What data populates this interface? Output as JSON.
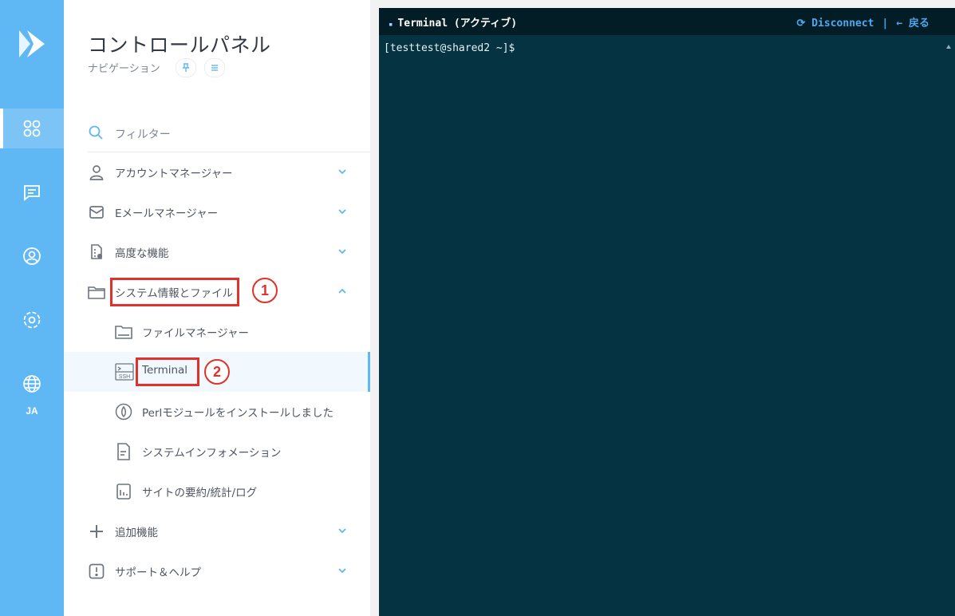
{
  "rail": {
    "items": [
      {
        "name": "dashboard",
        "active": true
      },
      {
        "name": "messages",
        "active": false
      },
      {
        "name": "account",
        "active": false
      },
      {
        "name": "settings",
        "active": false
      },
      {
        "name": "language",
        "active": false
      }
    ],
    "lang": "JA"
  },
  "nav": {
    "title": "コントロールパネル",
    "subtitle": "ナビゲーション",
    "filter_label": "フィルター",
    "items": [
      {
        "label": "アカウントマネージャー",
        "icon": "user-icon",
        "expandable": true,
        "expanded": false
      },
      {
        "label": "Eメールマネージャー",
        "icon": "mail-icon",
        "expandable": true,
        "expanded": false
      },
      {
        "label": "高度な機能",
        "icon": "advanced-settings-icon",
        "expandable": true,
        "expanded": false
      },
      {
        "label": "システム情報とファイル",
        "icon": "folder-icon",
        "expandable": true,
        "expanded": true
      }
    ],
    "subitems": [
      {
        "label": "ファイルマネージャー",
        "icon": "folder-icon"
      },
      {
        "label": "Terminal",
        "icon": "ssh-terminal-icon",
        "selected": true
      },
      {
        "label": "Perlモジュールをインストールしました",
        "icon": "perl-icon"
      },
      {
        "label": "システムインフォメーション",
        "icon": "document-icon"
      },
      {
        "label": "サイトの要約/統計/ログ",
        "icon": "stats-icon"
      }
    ],
    "bottom_items": [
      {
        "label": "追加機能",
        "icon": "plus-icon"
      },
      {
        "label": "サポート＆ヘルプ",
        "icon": "alert-icon"
      }
    ]
  },
  "annotations": {
    "step1": "1",
    "step2": "2",
    "color": "#e0322a"
  },
  "terminal": {
    "title": "Terminal (アクティブ)",
    "disconnect": "Disconnect",
    "separator": "|",
    "back": "← 戻る",
    "prompt": "[testtest@shared2 ~]$",
    "bg_color": "#063341",
    "accent_color": "#4ea8f0"
  }
}
